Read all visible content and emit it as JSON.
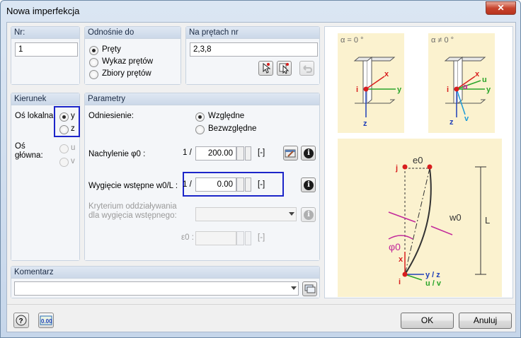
{
  "window": {
    "title": "Nowa imperfekcja",
    "close_label": "✕"
  },
  "nr": {
    "header": "Nr:",
    "value": "1"
  },
  "odnosnie": {
    "header": "Odnośnie do",
    "options": [
      "Pręty",
      "Wykaz prętów",
      "Zbiory prętów"
    ],
    "selected": 0
  },
  "naprt": {
    "header": "Na prętach nr",
    "value": "2,3,8"
  },
  "kierunek": {
    "header": "Kierunek",
    "os_lokalna": "Oś lokalna:",
    "y": "y",
    "z": "z",
    "os_glowna1": "Oś",
    "os_glowna2": "główna:",
    "u": "u",
    "v": "v"
  },
  "parametry": {
    "header": "Parametry",
    "odniesienie": "Odniesienie:",
    "wzgledne": "Względne",
    "bezwzgledne": "Bezwzględne",
    "nachylenie": "Nachylenie φ0 :",
    "nach_prefix": "1 /",
    "nach_value": "200.00",
    "nach_unit": "[-]",
    "wygiecie": "Wygięcie wstępne w0/L :",
    "wyg_prefix": "1 /",
    "wyg_value": "0.00",
    "wyg_unit": "[-]",
    "kryterium1": "Kryterium oddziaływania",
    "kryterium2": "dla wygięcia wstępnego:",
    "e0_label": "ε0 :",
    "e0_unit": "[-]"
  },
  "komentarz": {
    "header": "Komentarz",
    "value": ""
  },
  "buttons": {
    "ok": "OK",
    "cancel": "Anuluj"
  },
  "diagram": {
    "alpha0": "α = 0 °",
    "alphaNot0": "α ≠ 0 °",
    "x": "x",
    "y": "y",
    "z": "z",
    "i": "i",
    "u": "u",
    "v": "v",
    "alpha": "α",
    "e0": "e0",
    "j": "j",
    "w0": "w0",
    "phi0": "φ0",
    "L": "L",
    "yz": "y / z",
    "uv": "u / v"
  },
  "colors": {
    "accent_red": "#d81e1e",
    "accent_green": "#2aa52a",
    "accent_blue": "#1f3fb8",
    "accent_cyan": "#1c9ad6",
    "accent_magenta": "#c2289a",
    "diagram_bg": "#fbf2cf",
    "highlight": "#1c25c9"
  }
}
